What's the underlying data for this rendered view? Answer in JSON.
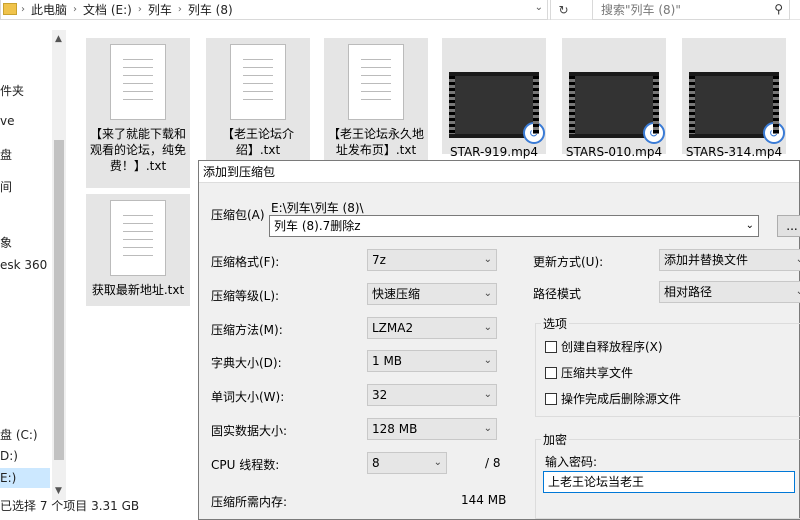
{
  "explorer": {
    "breadcrumb": [
      "此电脑",
      "文档 (E:)",
      "列车",
      "列车 (8)"
    ],
    "search_placeholder": "搜索\"列车 (8)\"",
    "nav_items": [
      "件夹",
      "ve",
      "盘",
      "间",
      "象",
      "esk 360",
      "盘 (C:)",
      "D:)",
      "E:)"
    ],
    "status": "已选择 7 个项目  3.31 GB",
    "files": [
      {
        "name": "【来了就能下载和观看的论坛，纯免费！】.txt",
        "type": "txt"
      },
      {
        "name": "【老王论坛介绍】.txt",
        "type": "txt"
      },
      {
        "name": "【老王论坛永久地址发布页】.txt",
        "type": "txt"
      },
      {
        "name": "STAR-919.mp4",
        "type": "video"
      },
      {
        "name": "STARS-010.mp4",
        "type": "video"
      },
      {
        "name": "STARS-314.mp4",
        "type": "video"
      },
      {
        "name": "获取最新地址.txt",
        "type": "txt"
      }
    ]
  },
  "dialog": {
    "title": "添加到压缩包",
    "archive_label": "压缩包(A)",
    "archive_path": "E:\\列车\\列车 (8)\\",
    "archive_name": "列车 (8).7删除z",
    "browse_label": "...",
    "format_label": "压缩格式(F):",
    "format_value": "7z",
    "level_label": "压缩等级(L):",
    "level_value": "快速压缩",
    "method_label": "压缩方法(M):",
    "method_value": "LZMA2",
    "dict_label": "字典大小(D):",
    "dict_value": "1 MB",
    "word_label": "单词大小(W):",
    "word_value": "32",
    "solid_label": "固实数据大小:",
    "solid_value": "128 MB",
    "threads_label": "CPU 线程数:",
    "threads_value": "8",
    "threads_max": "/ 8",
    "memory_label": "压缩所需内存:",
    "memory_value": "144 MB",
    "update_label": "更新方式(U):",
    "update_value": "添加并替换文件",
    "path_label": "路径模式",
    "path_value": "相对路径",
    "options_title": "选项",
    "options": [
      "创建自释放程序(X)",
      "压缩共享文件",
      "操作完成后删除源文件"
    ],
    "encrypt_title": "加密",
    "password_label": "输入密码:",
    "password_value": "上老王论坛当老王"
  }
}
